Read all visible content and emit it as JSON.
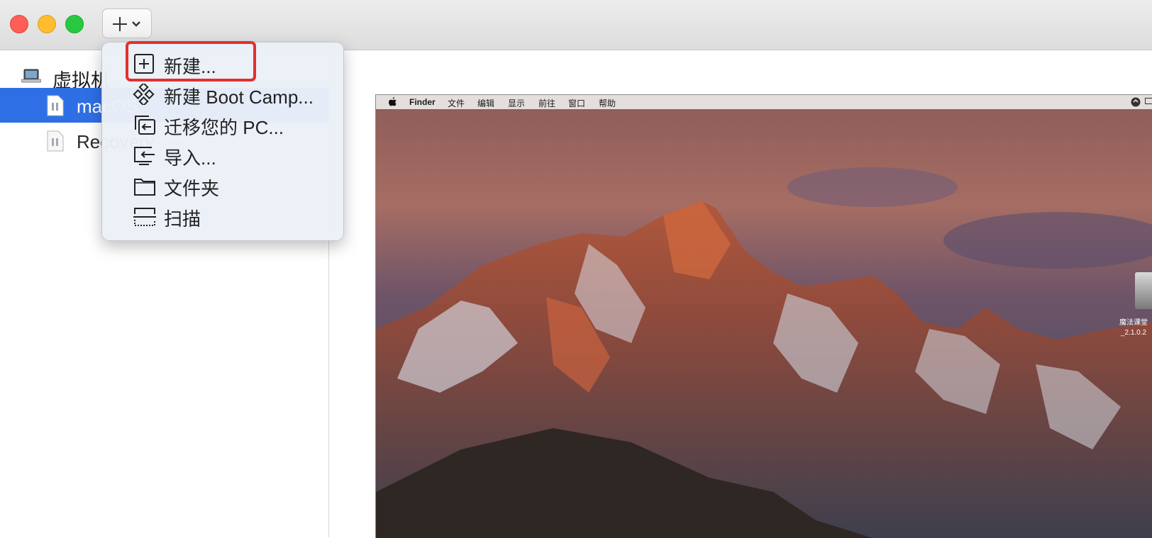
{
  "toolbar": {
    "add_button": "add-dropdown"
  },
  "sidebar": {
    "header_label": "虚拟机",
    "items": [
      {
        "label": "macOS",
        "selected": true
      },
      {
        "label": "Recovery",
        "selected": false
      }
    ]
  },
  "menu": {
    "items": [
      {
        "label": "新建...",
        "icon": "plus-box-icon"
      },
      {
        "label": "新建 Boot Camp...",
        "icon": "bootcamp-diamond-icon"
      },
      {
        "label": "迁移您的 PC...",
        "icon": "migrate-pc-icon"
      },
      {
        "label": "导入...",
        "icon": "import-icon"
      },
      {
        "label": "文件夹",
        "icon": "folder-icon"
      },
      {
        "label": "扫描",
        "icon": "scan-icon"
      }
    ]
  },
  "guest": {
    "menubar": [
      "Finder",
      "文件",
      "编辑",
      "显示",
      "前往",
      "窗口",
      "帮助"
    ],
    "desktop_item_label_1": "魔法课堂",
    "desktop_item_label_2": "_2.1.0.2"
  },
  "colors": {
    "selection": "#2f6fe6",
    "highlight": "#e0312f",
    "traffic_close": "#fd5f57",
    "traffic_min": "#febc2e",
    "traffic_zoom": "#28c840"
  }
}
